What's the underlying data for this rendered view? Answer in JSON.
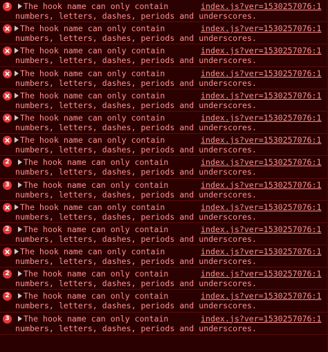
{
  "messages": [
    {
      "icon": "count",
      "count": "3",
      "text1": "The hook name can only contain",
      "text2": "numbers, letters, dashes, periods and underscores.",
      "source": "index.js?ver=1530257076:1"
    },
    {
      "icon": "error",
      "count": "",
      "text1": "The hook name can only contain",
      "text2": "numbers, letters, dashes, periods and underscores.",
      "source": "index.js?ver=1530257076:1"
    },
    {
      "icon": "error",
      "count": "",
      "text1": "The hook name can only contain",
      "text2": "numbers, letters, dashes, periods and underscores.",
      "source": "index.js?ver=1530257076:1"
    },
    {
      "icon": "error",
      "count": "",
      "text1": "The hook name can only contain",
      "text2": "numbers, letters, dashes, periods and underscores.",
      "source": "index.js?ver=1530257076:1"
    },
    {
      "icon": "error",
      "count": "",
      "text1": "The hook name can only contain",
      "text2": "numbers, letters, dashes, periods and underscores.",
      "source": "index.js?ver=1530257076:1"
    },
    {
      "icon": "error",
      "count": "",
      "text1": "The hook name can only contain",
      "text2": "numbers, letters, dashes, periods and underscores.",
      "source": "index.js?ver=1530257076:1"
    },
    {
      "icon": "error",
      "count": "",
      "text1": "The hook name can only contain",
      "text2": "numbers, letters, dashes, periods and underscores.",
      "source": "index.js?ver=1530257076:1"
    },
    {
      "icon": "count",
      "count": "2",
      "text1": "The hook name can only contain",
      "text2": "numbers, letters, dashes, periods and underscores.",
      "source": "index.js?ver=1530257076:1"
    },
    {
      "icon": "count",
      "count": "3",
      "text1": "The hook name can only contain",
      "text2": "numbers, letters, dashes, periods and underscores.",
      "source": "index.js?ver=1530257076:1"
    },
    {
      "icon": "error",
      "count": "",
      "text1": "The hook name can only contain",
      "text2": "numbers, letters, dashes, periods and underscores.",
      "source": "index.js?ver=1530257076:1"
    },
    {
      "icon": "count",
      "count": "2",
      "text1": "The hook name can only contain",
      "text2": "numbers, letters, dashes, periods and underscores.",
      "source": "index.js?ver=1530257076:1"
    },
    {
      "icon": "error",
      "count": "",
      "text1": "The hook name can only contain",
      "text2": "numbers, letters, dashes, periods and underscores.",
      "source": "index.js?ver=1530257076:1"
    },
    {
      "icon": "count",
      "count": "2",
      "text1": "The hook name can only contain",
      "text2": "numbers, letters, dashes, periods and underscores.",
      "source": "index.js?ver=1530257076:1"
    },
    {
      "icon": "count",
      "count": "2",
      "text1": "The hook name can only contain",
      "text2": "numbers, letters, dashes, periods and underscores.",
      "source": "index.js?ver=1530257076:1"
    },
    {
      "icon": "count",
      "count": "3",
      "text1": "The hook name can only contain",
      "text2": "numbers, letters, dashes, periods and underscores.",
      "source": "index.js?ver=1530257076:1"
    }
  ],
  "colors": {
    "background": "#2a0000",
    "text": "#ff8f8f",
    "badge": "#e0383a",
    "divider": "#5a0c0c"
  }
}
